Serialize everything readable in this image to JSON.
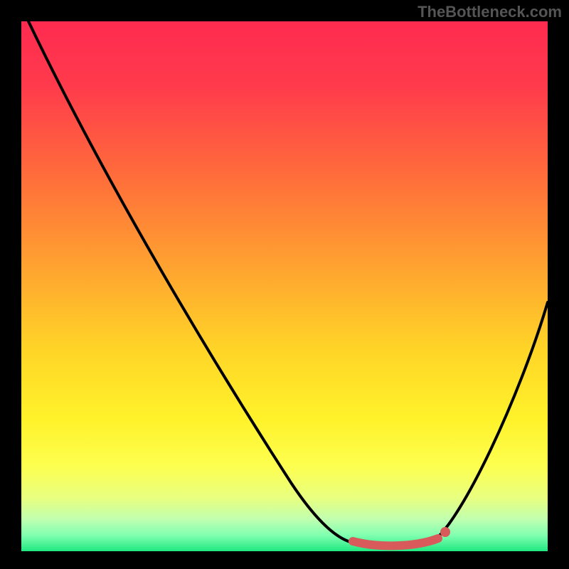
{
  "watermark": "TheBottleneck.com",
  "chart_data": {
    "type": "line",
    "title": "",
    "xlabel": "",
    "ylabel": "",
    "ylim": [
      0,
      100
    ],
    "xlim": [
      0,
      100
    ],
    "background_gradient": {
      "top": "#ff2b50",
      "mid_top": "#ffa82f",
      "mid": "#fff22a",
      "mid_bottom": "#c0ffb0",
      "bottom": "#20e880"
    },
    "series": [
      {
        "name": "bottleneck-curve",
        "color": "#000000",
        "x": [
          0,
          5,
          10,
          15,
          20,
          25,
          30,
          35,
          40,
          45,
          50,
          55,
          60,
          63,
          66,
          70,
          74,
          78,
          80,
          85,
          90,
          95,
          100
        ],
        "values": [
          100,
          92,
          84,
          76,
          68,
          60,
          52,
          44,
          36,
          28,
          20,
          13,
          7,
          3,
          1,
          1,
          1,
          2,
          4,
          12,
          25,
          38,
          47
        ]
      },
      {
        "name": "optimal-range-marker",
        "color": "#d85a5a",
        "x": [
          63,
          66,
          70,
          74,
          78,
          80
        ],
        "values": [
          2,
          1,
          1,
          1,
          2,
          3
        ]
      }
    ],
    "annotations": [
      {
        "type": "point",
        "name": "optimal-end",
        "x": 81,
        "y": 4,
        "color": "#d85a5a"
      }
    ]
  }
}
